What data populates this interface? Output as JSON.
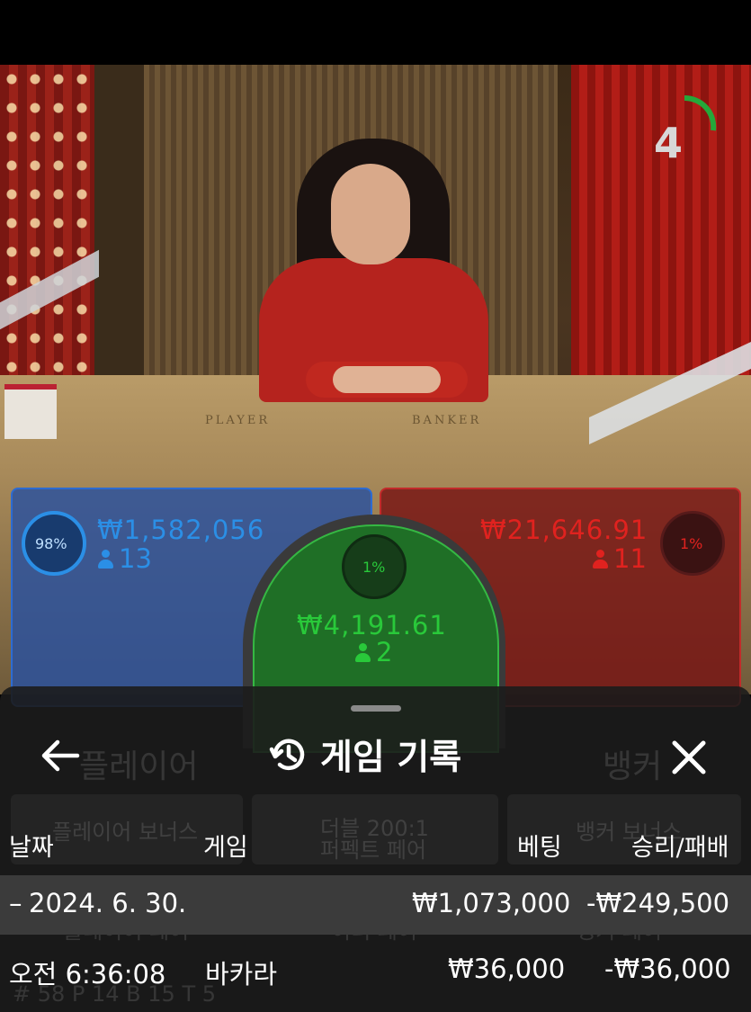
{
  "video": {
    "countdown": "4",
    "table_labels": {
      "player": "PLAYER",
      "banker": "BANKER"
    }
  },
  "bets": {
    "player": {
      "amount": "₩1,582,056",
      "count": "13",
      "percent": "98%",
      "color": "#2b8fe6"
    },
    "tie": {
      "amount": "₩4,191.61",
      "count": "2",
      "percent": "1%",
      "color": "#29c93a"
    },
    "banker": {
      "amount": "₩21,646.91",
      "count": "11",
      "percent": "1%",
      "color": "#e0221f"
    }
  },
  "history": {
    "title": "게임 기록",
    "title_icon": "history-icon",
    "back_icon": "arrow-left-icon",
    "close_icon": "close-icon",
    "background_labels": {
      "player": "플레이어",
      "banker": "뱅커",
      "player_bonus": "플레이어 보너스",
      "perfect_pair": "더블 200:1",
      "perfect_pair_2": "퍼펙트 페어",
      "banker_bonus": "뱅커 보너스",
      "player_pair": "플레이어 페어",
      "either_pair": "이더 페어",
      "banker_pair": "뱅커 페어",
      "stats": "# 58   P 14   B 15   T 5"
    },
    "columns": {
      "date": "날짜",
      "game": "게임",
      "bet": "베팅",
      "win_loss": "승리/패배"
    },
    "summary": {
      "date": "2024. 6. 30.",
      "bet": "₩1,073,000",
      "win_loss": "-₩249,500"
    },
    "rows": [
      {
        "time": "오전 6:36:08",
        "game": "바카라",
        "bet": "₩36,000",
        "win_loss": "-₩36,000"
      }
    ]
  }
}
